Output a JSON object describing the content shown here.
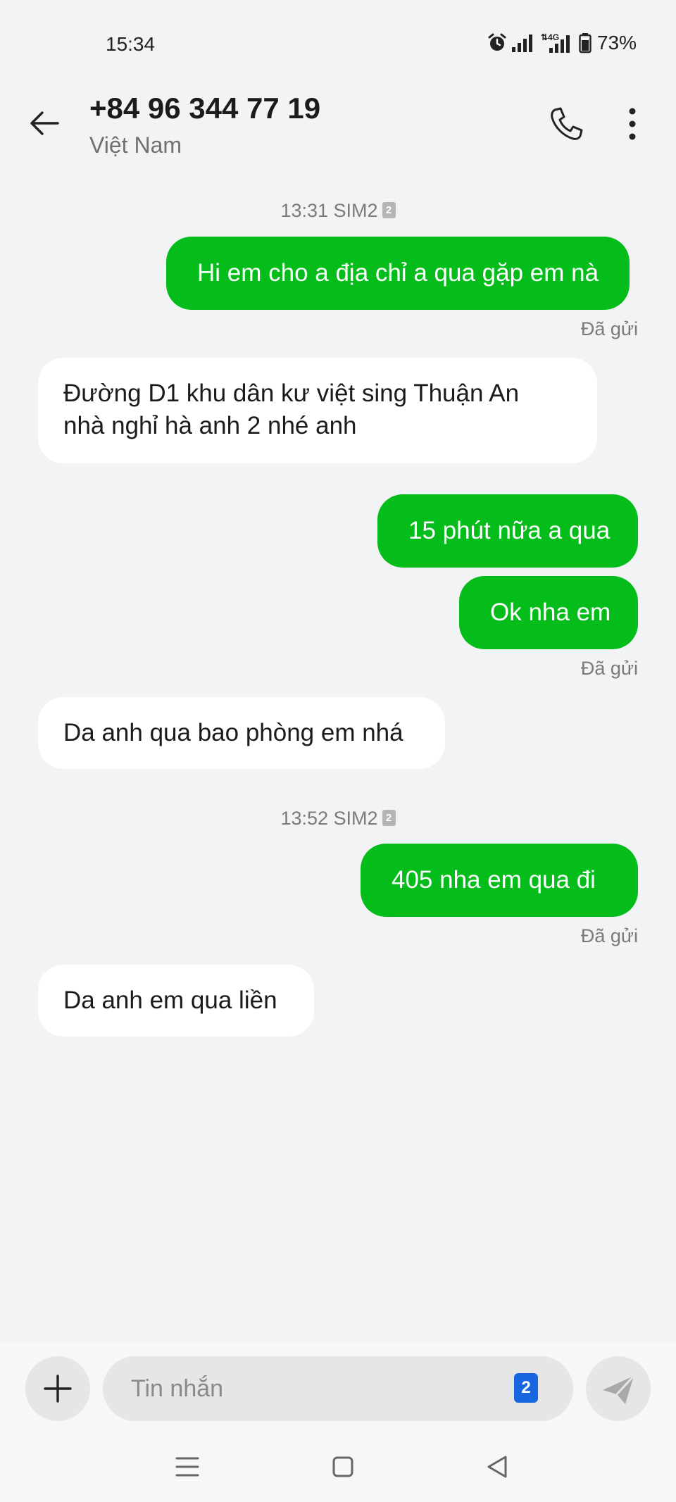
{
  "status_bar": {
    "time": "15:34",
    "network": "4G",
    "battery": "73%"
  },
  "header": {
    "contact_number": "+84 96 344 77 19",
    "contact_country": "Việt Nam"
  },
  "conversation": {
    "timestamps": [
      {
        "time": "13:31 SIM2",
        "sim": "2"
      },
      {
        "time": "13:52 SIM2",
        "sim": "2"
      }
    ],
    "messages": [
      {
        "direction": "out",
        "text": "Hi em cho a địa chỉ a qua gặp em nà"
      },
      {
        "direction": "in",
        "text": "Đường D1 khu dân kư việt sing Thuận An nhà nghỉ hà anh 2 nhé anh"
      },
      {
        "direction": "out",
        "text": "15 phút nữa a qua"
      },
      {
        "direction": "out",
        "text": "Ok nha em"
      },
      {
        "direction": "in",
        "text": "Da anh qua bao phòng em nhá"
      },
      {
        "direction": "out",
        "text": "405 nha em qua đi"
      },
      {
        "direction": "in",
        "text": "Da anh em qua liền"
      }
    ],
    "sent_status": "Đã gửi"
  },
  "composer": {
    "placeholder": "Tin nhắn",
    "sim_slot": "2"
  },
  "icons": {
    "accent_green": "#05bd1a",
    "sim_blue": "#1967e0"
  }
}
